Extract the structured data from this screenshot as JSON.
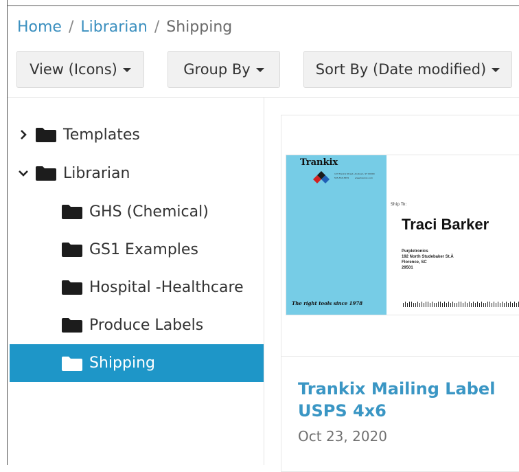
{
  "breadcrumb": {
    "items": [
      {
        "label": "Home",
        "link": true
      },
      {
        "label": "Librarian",
        "link": true
      },
      {
        "label": "Shipping",
        "link": false
      }
    ],
    "separator": "/"
  },
  "toolbar": {
    "view_label": "View (Icons)",
    "group_label": "Group By",
    "sort_label": "Sort By (Date modified)"
  },
  "tree": {
    "items": [
      {
        "label": "Templates",
        "level": 0,
        "expanded": false
      },
      {
        "label": "Librarian",
        "level": 0,
        "expanded": true
      },
      {
        "label": "GHS (Chemical)",
        "level": 1
      },
      {
        "label": "GS1 Examples",
        "level": 1
      },
      {
        "label": "Hospital -Healthcare",
        "level": 1
      },
      {
        "label": "Produce Labels",
        "level": 1
      },
      {
        "label": "Shipping",
        "level": 1,
        "selected": true
      }
    ]
  },
  "card": {
    "title": "Trankix Mailing Label USPS 4x6",
    "date": "Oct 23, 2020",
    "thumbnail": {
      "logo": "Trankix",
      "logo_fine_print": [
        "123 Trankix Street, Anytown, ST 00000",
        "555-555-5555",
        "www.trankix.com"
      ],
      "tagline": "The right tools since 1978",
      "ship_to": "Ship To:",
      "recipient": "Traci Barker",
      "address": [
        "Purpletronics",
        "192 North Studebaker St.Ä",
        "Florence,  SC",
        "29501"
      ]
    }
  },
  "colors": {
    "accent": "#1e96c8",
    "link": "#3a8fbf",
    "label_panel": "#76cce6"
  }
}
